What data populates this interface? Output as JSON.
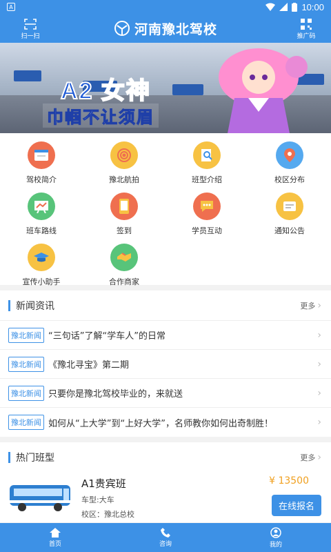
{
  "status": {
    "time": "10:00"
  },
  "header": {
    "title": "河南豫北驾校",
    "scan_label": "扫一扫",
    "promo_label": "推广码"
  },
  "banner": {
    "headline": "A2 女神",
    "slogan": "巾帼不让须眉"
  },
  "grid": [
    {
      "label": "驾校简介",
      "icon": "browser-icon",
      "color": "#ef6f4f"
    },
    {
      "label": "豫北航拍",
      "icon": "target-icon",
      "color": "#f7c243"
    },
    {
      "label": "班型介绍",
      "icon": "search-doc-icon",
      "color": "#f7c243"
    },
    {
      "label": "校区分布",
      "icon": "map-pin-icon",
      "color": "#55a9ef"
    },
    {
      "label": "班车路线",
      "icon": "route-board-icon",
      "color": "#58c47a"
    },
    {
      "label": "签到",
      "icon": "phone-icon",
      "color": "#ef6f4f"
    },
    {
      "label": "学员互动",
      "icon": "chat-icon",
      "color": "#ef6f4f"
    },
    {
      "label": "通知公告",
      "icon": "notice-icon",
      "color": "#f7c243"
    },
    {
      "label": "宣传小助手",
      "icon": "graduation-cap-icon",
      "color": "#f7c243"
    },
    {
      "label": "合作商家",
      "icon": "handshake-icon",
      "color": "#58c47a"
    }
  ],
  "news": {
    "title": "新闻资讯",
    "more": "更多",
    "items": [
      {
        "tag": "豫北新闻",
        "text": "“三句话”了解“学车人”的日常"
      },
      {
        "tag": "豫北新闻",
        "text": "《豫北寻宝》第二期"
      },
      {
        "tag": "豫北新闻",
        "text": "只要你是豫北驾校毕业的，来就送"
      },
      {
        "tag": "豫北新闻",
        "text": "如何从“上大学”到“上好大学”，名师教你如何出奇制胜！"
      }
    ]
  },
  "hot": {
    "title": "热门班型",
    "more": "更多",
    "course": {
      "name": "A1贵宾班",
      "type": "车型:大车",
      "campus": "校区：豫北总校",
      "price": "¥ 13500",
      "signup": "在线报名"
    }
  },
  "tabs": [
    {
      "label": "首页",
      "icon": "home-icon"
    },
    {
      "label": "咨询",
      "icon": "phone-call-icon"
    },
    {
      "label": "我的",
      "icon": "user-icon"
    }
  ],
  "colors": {
    "primary": "#3d91e6",
    "price": "#f0a020"
  }
}
